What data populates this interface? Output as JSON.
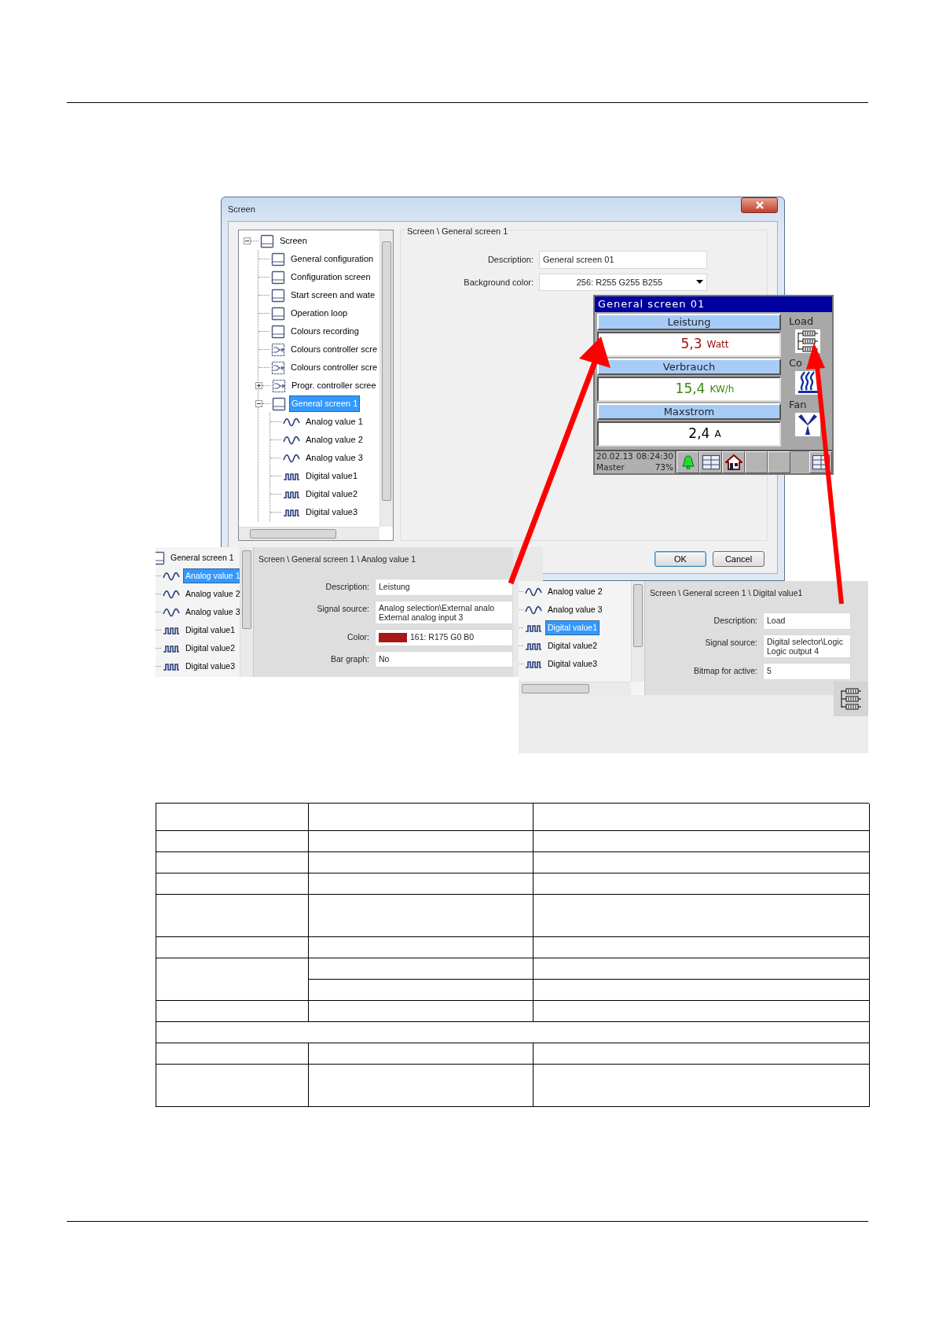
{
  "dialog": {
    "title": "Screen",
    "close": true,
    "tree": [
      {
        "label": "Screen",
        "kind": "screen",
        "selected": false,
        "expanded": true,
        "children": [
          {
            "label": "General configuration",
            "kind": "screen",
            "selected": false
          },
          {
            "label": "Configuration screen",
            "kind": "screen",
            "selected": false
          },
          {
            "label": "Start screen and wate",
            "kind": "screen",
            "selected": false
          },
          {
            "label": "Operation loop",
            "kind": "screen",
            "selected": false
          },
          {
            "label": "Colours recording",
            "kind": "screen",
            "selected": false
          },
          {
            "label": "Colours controller scre",
            "kind": "controller",
            "selected": false
          },
          {
            "label": "Colours controller scre",
            "kind": "controller",
            "selected": false
          },
          {
            "label": "Progr. controller scree",
            "kind": "controller",
            "selected": false,
            "expanded": false
          },
          {
            "label": "General screen 1",
            "kind": "screen",
            "selected": true,
            "expanded": true,
            "children": [
              {
                "label": "Analog value 1",
                "kind": "analog",
                "selected": false
              },
              {
                "label": "Analog value 2",
                "kind": "analog",
                "selected": false
              },
              {
                "label": "Analog value 3",
                "kind": "analog",
                "selected": false
              },
              {
                "label": "Digital value1",
                "kind": "digital",
                "selected": false
              },
              {
                "label": "Digital value2",
                "kind": "digital",
                "selected": false
              },
              {
                "label": "Digital value3",
                "kind": "digital",
                "selected": false
              }
            ]
          }
        ]
      }
    ],
    "breadcrumb": "Screen \\ General screen 1",
    "fields": [
      {
        "label": "Description:",
        "kind": "text",
        "value": "General screen 01"
      },
      {
        "label": "Background color:",
        "kind": "dropdown",
        "value": "256: R255 G255 B255"
      }
    ],
    "buttons": [
      "OK",
      "Cancel"
    ]
  },
  "display": {
    "title": "General screen  01",
    "values": [
      {
        "label": "Leistung",
        "value": "5,3",
        "unit": "Watt",
        "color": "#a01010"
      },
      {
        "label": "Verbrauch",
        "value": "15,4",
        "unit": "KW/h",
        "color": "#3a8a10"
      },
      {
        "label": "Maxstrom",
        "value": "2,4",
        "unit": "A",
        "color": "#000000"
      }
    ],
    "side": [
      {
        "label": "Load",
        "kind": "heater"
      },
      {
        "label": "Co",
        "kind": "heat"
      },
      {
        "label": "Fan",
        "kind": "fan"
      }
    ],
    "status": {
      "date": "20.02.13",
      "time": "08:24:30",
      "user": "Master",
      "percent": "73%"
    },
    "buttons": [
      {
        "kind": "bell"
      },
      {
        "kind": "grid"
      },
      {
        "kind": "home"
      },
      {
        "kind": "blank"
      },
      {
        "kind": "blank"
      },
      {
        "kind": "grid"
      }
    ]
  },
  "analog_panel": {
    "tree": [
      {
        "label": "General screen 1",
        "kind": "screen",
        "selected": false,
        "children": [
          {
            "label": "Analog value 1",
            "kind": "analog",
            "selected": true
          },
          {
            "label": "Analog value 2",
            "kind": "analog",
            "selected": false
          },
          {
            "label": "Analog value 3",
            "kind": "analog",
            "selected": false
          },
          {
            "label": "Digital value1",
            "kind": "digital",
            "selected": false
          },
          {
            "label": "Digital value2",
            "kind": "digital",
            "selected": false
          },
          {
            "label": "Digital value3",
            "kind": "digital",
            "selected": false
          }
        ]
      }
    ],
    "breadcrumb": "Screen \\ General screen 1 \\ Analog value 1",
    "fields": [
      {
        "label": "Description:",
        "kind": "text",
        "value": "Leistung"
      },
      {
        "label": "Signal source:",
        "kind": "multiline",
        "lines": [
          "Analog selection\\External analo",
          "External analog input 3"
        ]
      },
      {
        "label": "Color:",
        "kind": "color",
        "color": "#a81818",
        "value": "161: R175 G0 B0"
      },
      {
        "label": "Bar graph:",
        "kind": "text",
        "value": "No"
      }
    ]
  },
  "digital_panel": {
    "tree": [
      {
        "label": "Analog value 2",
        "kind": "analog",
        "selected": false
      },
      {
        "label": "Analog value 3",
        "kind": "analog",
        "selected": false
      },
      {
        "label": "Digital value1",
        "kind": "digital",
        "selected": true
      },
      {
        "label": "Digital value2",
        "kind": "digital",
        "selected": false
      },
      {
        "label": "Digital value3",
        "kind": "digital",
        "selected": false
      }
    ],
    "breadcrumb": "Screen \\ General screen 1 \\ Digital value1",
    "fields": [
      {
        "label": "Description:",
        "kind": "text",
        "value": "Load"
      },
      {
        "label": "Signal source:",
        "kind": "multiline",
        "lines": [
          "Digital selector\\Logic",
          "Logic output 4"
        ]
      },
      {
        "label": "Bitmap for active:",
        "kind": "text",
        "value": "5"
      }
    ],
    "preview": {
      "kind": "heater"
    }
  }
}
